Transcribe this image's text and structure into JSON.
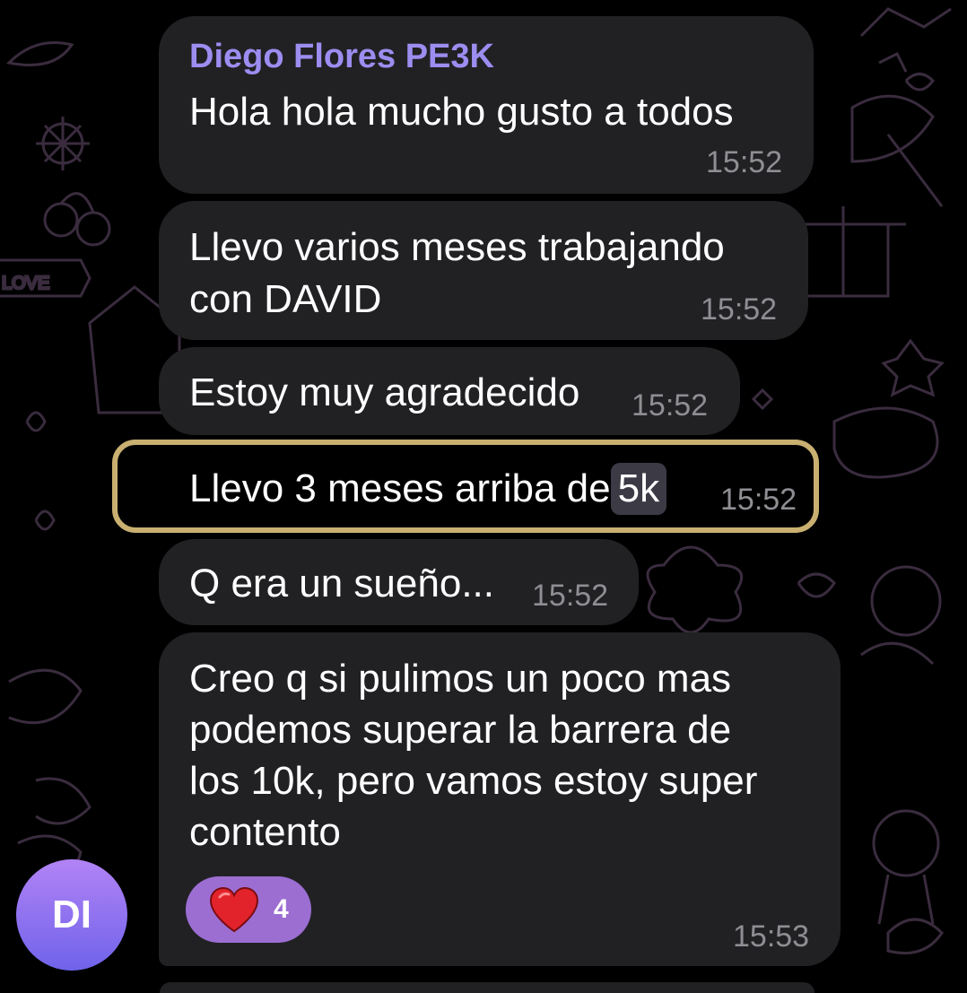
{
  "chat": {
    "sender_name": "Diego Flores PE3K",
    "avatar_initials": "DI",
    "messages": [
      {
        "lines": [
          "Hola hola mucho gusto a todos"
        ],
        "time": "15:52"
      },
      {
        "lines": [
          "Llevo varios meses trabajando",
          "con DAVID"
        ],
        "time": "15:52"
      },
      {
        "lines": [
          "Estoy muy agradecido"
        ],
        "time": "15:52"
      },
      {
        "text_before": "Llevo 3 meses arriba de",
        "highlight": "5k",
        "time": "15:52"
      },
      {
        "lines": [
          "Q era un sueño..."
        ],
        "time": "15:52"
      },
      {
        "lines": [
          "Creo q si pulimos un poco mas",
          "podemos superar la barrera de",
          "los 10k, pero vamos estoy super",
          "contento"
        ],
        "time": "15:53",
        "reaction": {
          "icon": "heart-icon",
          "count": "4"
        }
      }
    ],
    "doodle_label": "LOVE"
  },
  "colors": {
    "background": "#000000",
    "bubble": "#212124",
    "sender_name": "#9c8df0",
    "timestamp": "#8e8e93",
    "highlight_frame": "#c9b071",
    "reaction_bg": "#9c6ed2",
    "avatar_gradient": [
      "#b283f5",
      "#6f63ea"
    ]
  }
}
